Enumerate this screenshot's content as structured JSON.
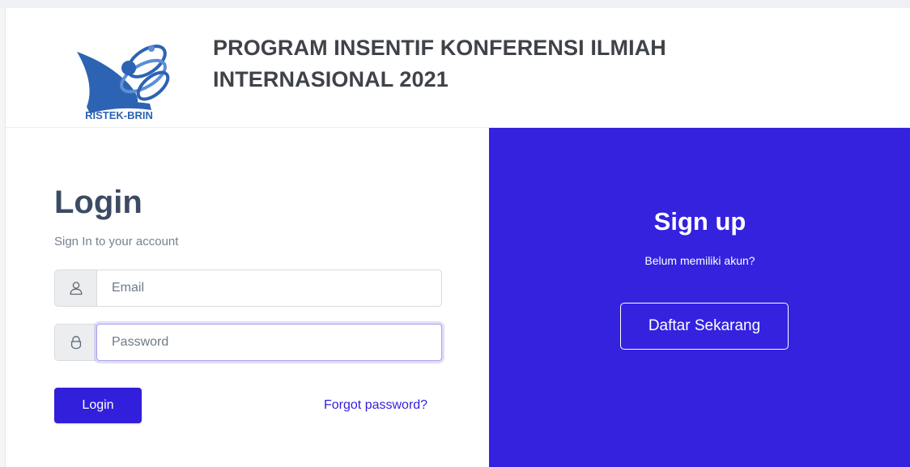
{
  "header": {
    "logo_text": "RISTEK-BRIN",
    "title_line1": "PROGRAM INSENTIF KONFERENSI ILMIAH",
    "title_line2": "INTERNASIONAL 2021"
  },
  "login": {
    "title": "Login",
    "subtitle": "Sign In to your account",
    "email_placeholder": "Email",
    "email_icon": "user-icon",
    "password_placeholder": "Password",
    "password_icon": "lock-icon",
    "button_label": "Login",
    "forgot_label": "Forgot password?"
  },
  "signup": {
    "title": "Sign up",
    "subtitle": "Belum memiliki akun?",
    "button_label": "Daftar Sekarang"
  },
  "colors": {
    "primary": "#321fdb",
    "signup_background": "#3422df",
    "text": "#3c4b64",
    "muted": "#768192"
  }
}
